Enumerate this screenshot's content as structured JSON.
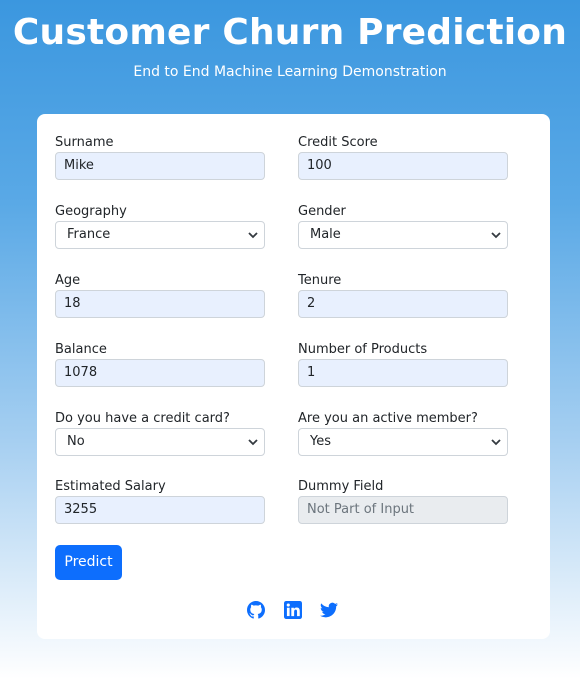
{
  "header": {
    "title": "Customer Churn Prediction",
    "subtitle": "End to End Machine Learning Demonstration"
  },
  "form": {
    "surname": {
      "label": "Surname",
      "value": "Mike"
    },
    "credit_score": {
      "label": "Credit Score",
      "value": "100"
    },
    "geography": {
      "label": "Geography",
      "value": "France"
    },
    "gender": {
      "label": "Gender",
      "value": "Male"
    },
    "age": {
      "label": "Age",
      "value": "18"
    },
    "tenure": {
      "label": "Tenure",
      "value": "2"
    },
    "balance": {
      "label": "Balance",
      "value": "1078"
    },
    "num_products": {
      "label": "Number of Products",
      "value": "1"
    },
    "has_credit_card": {
      "label": "Do you have a credit card?",
      "value": "No"
    },
    "active_member": {
      "label": "Are you an active member?",
      "value": "Yes"
    },
    "estimated_salary": {
      "label": "Estimated Salary",
      "value": "3255"
    },
    "dummy_field": {
      "label": "Dummy Field",
      "value": "Not Part of Input"
    },
    "predict_label": "Predict"
  },
  "footer": {
    "icons": [
      "github-icon",
      "linkedin-icon",
      "twitter-icon"
    ],
    "accent_color": "#0d6efd"
  }
}
